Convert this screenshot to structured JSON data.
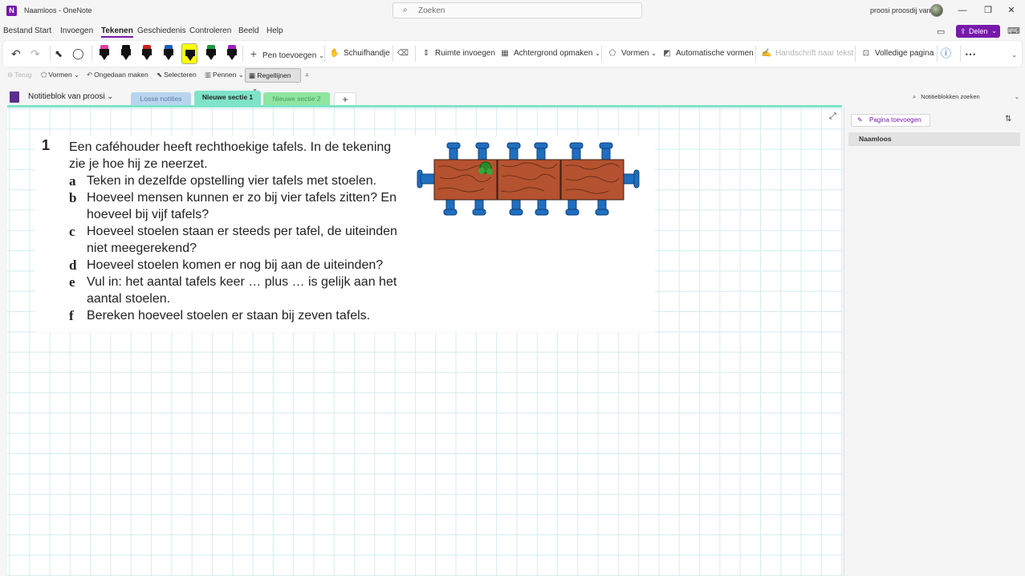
{
  "window": {
    "title": "Naamloos - OneNote",
    "logo_letter": "N"
  },
  "search": {
    "placeholder": "Zoeken"
  },
  "user": {
    "name": "proosi proosdij van"
  },
  "window_controls": {
    "minimize": "—",
    "restore": "❐",
    "close": "✕"
  },
  "menu": {
    "items": [
      "Bestand",
      "Start",
      "Invoegen",
      "Tekenen",
      "Geschiedenis",
      "Controleren",
      "Beeld",
      "Help"
    ],
    "active": "Tekenen",
    "share_label": "Delen"
  },
  "ribbon": {
    "add_pen": "Pen toevoegen",
    "hand": "Schuifhandje",
    "insert_space": "Ruimte invoegen",
    "background": "Achtergrond opmaken",
    "shapes": "Vormen",
    "auto_shapes": "Automatische vormen",
    "ink_to_text": "Handschrift naar tekst",
    "full_page": "Volledige pagina",
    "pens": [
      {
        "cap": "#e040a0",
        "selected": false
      },
      {
        "cap": "#111111",
        "selected": false
      },
      {
        "cap": "#d02020",
        "selected": false
      },
      {
        "cap": "#1e5fb8",
        "selected": false
      },
      {
        "cap": "#ffff00",
        "selected": true
      },
      {
        "cap": "#1e9a3a",
        "selected": false
      },
      {
        "cap": "#a020c0",
        "selected": false
      }
    ]
  },
  "subbar": {
    "back": "Terug",
    "shapes": "Vormen",
    "undo": "Ongedaan maken",
    "select": "Selecteren",
    "pens": "Pennen",
    "rulers": "Regellijnen"
  },
  "notebook": {
    "name": "Notitieblok van proosi",
    "search": "Notitieblokken zoeken",
    "sections": [
      {
        "label": "Losse notities",
        "color": "#b9d5ee",
        "text": "#5a7da3",
        "active": false
      },
      {
        "label": "Nieuwe sectie 1",
        "color": "#7fe3c8",
        "text": "#222222",
        "active": true
      },
      {
        "label": "Nieuwe sectie 2",
        "color": "#8ee6a0",
        "text": "#4e9a63",
        "active": false
      }
    ],
    "add_section": "+"
  },
  "exercise": {
    "number": "1",
    "intro": "Een caféhouder heeft rechthoekige tafels. In de tekening zie je hoe hij ze neerzet.",
    "questions": [
      {
        "letter": "a",
        "text": "Teken in dezelfde opstelling vier tafels met stoelen."
      },
      {
        "letter": "b",
        "text": "Hoeveel mensen kunnen er zo bij vier tafels zitten? En hoeveel bij vijf tafels?"
      },
      {
        "letter": "c",
        "text": "Hoeveel stoelen staan er steeds per tafel, de uiteinden niet meegerekend?"
      },
      {
        "letter": "d",
        "text": "Hoeveel stoelen komen er nog bij aan de uiteinden?"
      },
      {
        "letter": "e",
        "text": "Vul in: het aantal tafels keer … plus … is gelijk aan het aantal stoelen."
      },
      {
        "letter": "f",
        "text": "Bereken hoeveel stoelen er staan bij zeven tafels."
      }
    ]
  },
  "pages": {
    "add_label": "Pagina toevoegen",
    "items": [
      "Naamloos"
    ]
  },
  "colors": {
    "accent": "#7719aa",
    "section_active": "#7fe3c8",
    "grid": "#d4ecee"
  }
}
